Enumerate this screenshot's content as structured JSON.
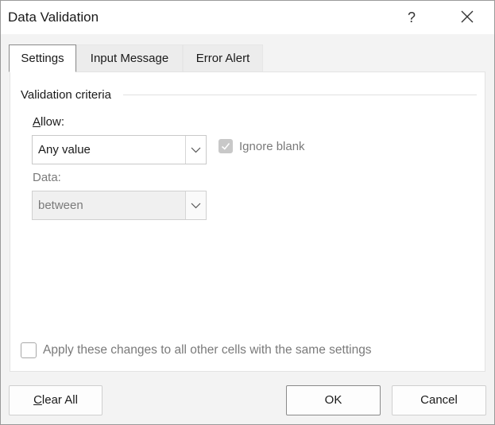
{
  "window": {
    "title": "Data Validation",
    "help_label": "?",
    "close_icon": "close-icon"
  },
  "tabs": [
    {
      "label": "Settings",
      "active": true
    },
    {
      "label": "Input Message",
      "active": false
    },
    {
      "label": "Error Alert",
      "active": false
    }
  ],
  "settings": {
    "group_label": "Validation criteria",
    "allow": {
      "label_access_key": "A",
      "label_rest": "llow:",
      "value": "Any value"
    },
    "ignore_blank": {
      "label": "Ignore blank",
      "checked": true,
      "disabled": true
    },
    "data": {
      "label": "Data:",
      "value": "between",
      "disabled": true
    },
    "apply_all": {
      "label": "Apply these changes to all other cells with the same settings",
      "checked": false,
      "disabled": true
    }
  },
  "buttons": {
    "clear_all_access_key": "C",
    "clear_all_rest": "lear All",
    "ok": "OK",
    "cancel": "Cancel"
  }
}
